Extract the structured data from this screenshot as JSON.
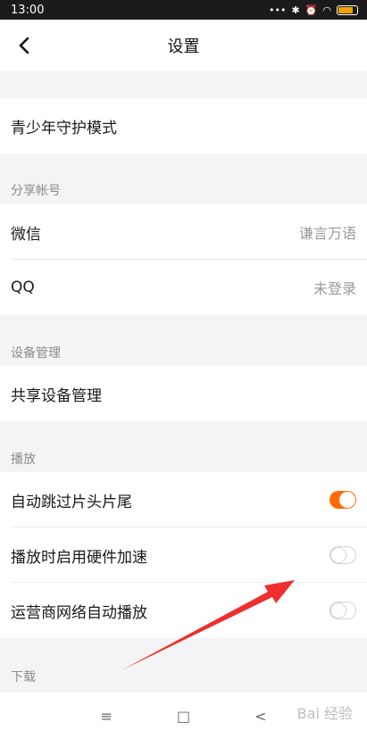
{
  "status_bar": {
    "time": "13:00",
    "signal_text": "•••"
  },
  "header": {
    "title": "设置"
  },
  "rows": {
    "teen_mode": "青少年守护模式",
    "section_share": "分享帐号",
    "wechat_label": "微信",
    "wechat_value": "谦言万语",
    "qq_label": "QQ",
    "qq_value": "未登录",
    "section_device": "设备管理",
    "shared_device": "共享设备管理",
    "section_playback": "播放",
    "skip_intro": "自动跳过片头片尾",
    "hardware_accel": "播放时启用硬件加速",
    "carrier_autoplay": "运营商网络自动播放",
    "section_download": "下载"
  },
  "toggles": {
    "skip_intro": true,
    "hardware_accel": false,
    "carrier_autoplay": false
  },
  "bottom_nav": {
    "menu": "≡",
    "home": "□",
    "back": "<"
  },
  "watermark": "Bai 经验",
  "colors": {
    "accent": "#ff6a00",
    "arrow": "#ef2e2e"
  }
}
